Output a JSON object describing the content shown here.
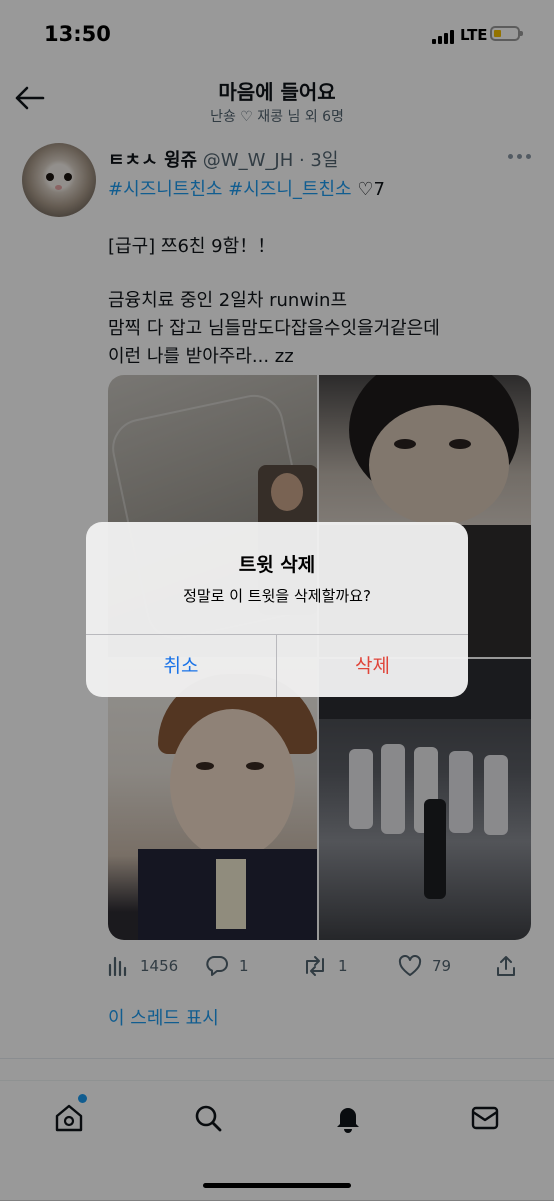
{
  "status_bar": {
    "time": "13:50",
    "network": "LTE"
  },
  "header": {
    "title": "마음에 들어요",
    "subtitle": "난숑 ♡ 재콩 님 외 6명"
  },
  "tweet": {
    "display_name": "ㅌㅊㅅ 윙쥬",
    "handle": " @W_W_JH · 3일",
    "hashtags": "#시즈니트친소 #시즈니_트친소",
    "like_badge": "♡7",
    "lines": [
      "[급구] 쯔6친 9함！！",
      "금융치료 중인 2일차 runwin프",
      "맘찍 다 잡고 님들맘도다잡을수잇을거같은데",
      "이런 나를 받아주라... zz"
    ],
    "stats": {
      "views": "1456",
      "replies": "1",
      "retweets": "1",
      "likes": "79"
    },
    "show_thread": "이 스레드 표시"
  },
  "icons": {
    "back": "back-arrow-icon",
    "more": "more-icon",
    "views": "views-chart-icon",
    "reply": "reply-icon",
    "retweet": "retweet-icon",
    "like": "heart-icon",
    "share": "share-icon",
    "home": "home-icon",
    "search": "search-icon",
    "notifications": "bell-icon",
    "messages": "mail-icon"
  },
  "alert": {
    "title": "트윗 삭제",
    "message": "정말로 이 트윗을 삭제할까요?",
    "cancel_label": "취소",
    "delete_label": "삭제"
  },
  "colors": {
    "accent": "#1d9bf0",
    "destructive": "#e0453a",
    "cancel": "#1a73e8"
  }
}
